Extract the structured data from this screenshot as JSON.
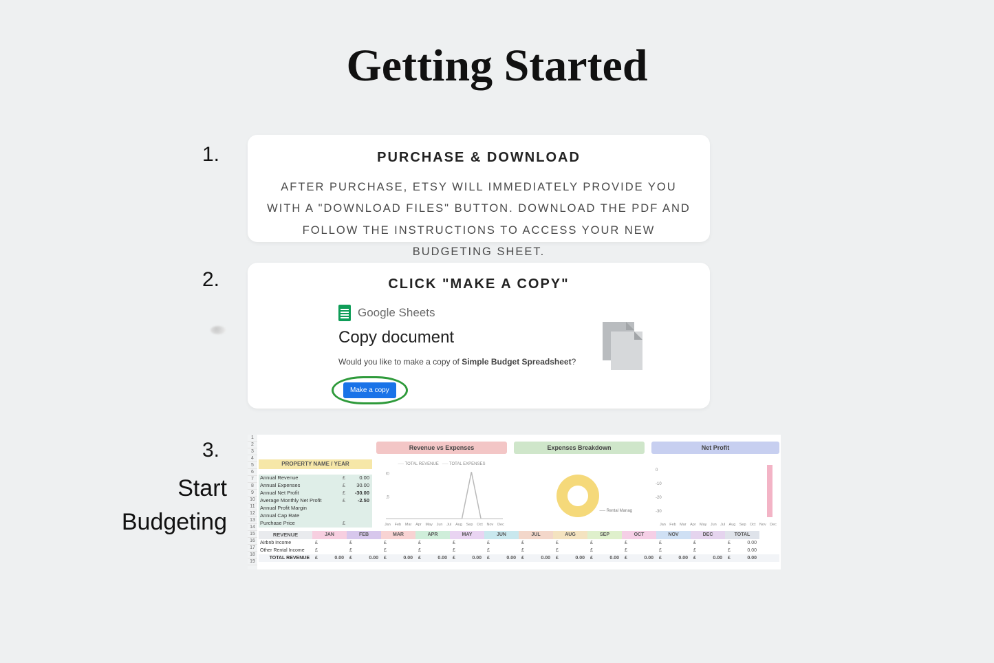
{
  "title": "Getting Started",
  "steps": {
    "one": {
      "num": "1.",
      "heading": "PURCHASE & DOWNLOAD",
      "body": "AFTER PURCHASE, ETSY WILL IMMEDIATELY PROVIDE YOU WITH A \"DOWNLOAD FILES\" BUTTON. DOWNLOAD THE PDF AND FOLLOW THE INSTRUCTIONS TO ACCESS YOUR NEW BUDGETING SHEET."
    },
    "two": {
      "num": "2.",
      "heading": "CLICK \"MAKE A COPY\"",
      "gsheets_label": "Google Sheets",
      "copy_title": "Copy document",
      "prompt_prefix": "Would you like to make a copy of ",
      "prompt_bold": "Simple Budget Spreadsheet",
      "prompt_suffix": "?",
      "button": "Make a copy"
    },
    "three": {
      "num": "3.",
      "label_line1": "Start",
      "label_line2": "Budgeting"
    }
  },
  "sheet": {
    "row_numbers": [
      "1",
      "2",
      "3",
      "4",
      "5",
      "6",
      "7",
      "8",
      "9",
      "10",
      "11",
      "12",
      "13",
      "14",
      "15",
      "16",
      "17",
      "18",
      "19"
    ],
    "property_header": "PROPERTY NAME / YEAR",
    "kpis": [
      {
        "label": "Annual Revenue",
        "currency": "£",
        "value": "0.00"
      },
      {
        "label": "Annual Expenses",
        "currency": "£",
        "value": "30.00"
      },
      {
        "label": "Annual Net Profit",
        "currency": "£",
        "value": "-30.00"
      },
      {
        "label": "Average Monthly Net Profit",
        "currency": "£",
        "value": "-2.50"
      },
      {
        "label": "Annual Profit Margin",
        "currency": "",
        "value": ""
      },
      {
        "label": "Annual Cap Rate",
        "currency": "",
        "value": ""
      },
      {
        "label": "Purchase Price",
        "currency": "£",
        "value": ""
      }
    ],
    "chart_headers": {
      "rev": "Revenue vs Expenses",
      "exp": "Expenses Breakdown",
      "net": "Net Profit"
    },
    "legend": {
      "total_revenue": "TOTAL REVENUE",
      "total_expenses": "TOTAL EXPENSES"
    },
    "donut_label": "Rental Manag",
    "months_short": [
      "Jan",
      "Feb",
      "Mar",
      "Apr",
      "May",
      "Jun",
      "Jul",
      "Aug",
      "Sep",
      "Oct",
      "Nov",
      "Dec"
    ],
    "net_ticks": [
      "0",
      "-10",
      "-20",
      "-30"
    ],
    "table": {
      "row_label_header": "REVENUE",
      "months": [
        "JAN",
        "FEB",
        "MAR",
        "APR",
        "MAY",
        "JUN",
        "JUL",
        "AUG",
        "SEP",
        "OCT",
        "NOV",
        "DEC",
        "TOTAL"
      ],
      "month_colors": [
        "#f7cfe0",
        "#d7c7ec",
        "#f8d3d3",
        "#cfeeda",
        "#e9d4f2",
        "#c9e8ee",
        "#f3d7ca",
        "#f4e3c0",
        "#dff0cc",
        "#f5cfe6",
        "#cfe0f4",
        "#e5d4ee",
        "#dfe3ea"
      ],
      "rows": [
        {
          "label": "Airbnb Income",
          "cells": [
            "£",
            "£",
            "£",
            "£",
            "£",
            "£",
            "£",
            "£",
            "£",
            "£",
            "£",
            "£",
            "£"
          ],
          "total": "0.00"
        },
        {
          "label": "Other Rental Income",
          "cells": [
            "£",
            "£",
            "£",
            "£",
            "£",
            "£",
            "£",
            "£",
            "£",
            "£",
            "£",
            "£",
            "£"
          ],
          "total": "0.00"
        }
      ],
      "total_row": {
        "label": "TOTAL REVENUE",
        "cells": [
          "0.00",
          "0.00",
          "0.00",
          "0.00",
          "0.00",
          "0.00",
          "0.00",
          "0.00",
          "0.00",
          "0.00",
          "0.00",
          "0.00",
          "0.00"
        ],
        "currency": "£"
      }
    }
  },
  "chart_data": [
    {
      "type": "line",
      "title": "Revenue vs Expenses",
      "x": [
        "Jan",
        "Feb",
        "Mar",
        "Apr",
        "May",
        "Jun",
        "Jul",
        "Aug",
        "Sep",
        "Oct",
        "Nov",
        "Dec"
      ],
      "series": [
        {
          "name": "TOTAL REVENUE",
          "values": [
            0,
            0,
            0,
            0,
            0,
            0,
            0,
            0,
            0,
            0,
            0,
            0
          ]
        },
        {
          "name": "TOTAL EXPENSES",
          "values": [
            0,
            0,
            0,
            0,
            0,
            0,
            0,
            0,
            30,
            0,
            0,
            0
          ]
        }
      ],
      "ylim": [
        0,
        30
      ]
    },
    {
      "type": "pie",
      "title": "Expenses Breakdown",
      "categories": [
        "Rental Manag"
      ],
      "values": [
        30
      ]
    },
    {
      "type": "bar",
      "title": "Net Profit",
      "categories": [
        "Jan",
        "Feb",
        "Mar",
        "Apr",
        "May",
        "Jun",
        "Jul",
        "Aug",
        "Sep",
        "Oct",
        "Nov",
        "Dec"
      ],
      "values": [
        0,
        0,
        0,
        0,
        0,
        0,
        0,
        0,
        0,
        0,
        0,
        -30
      ],
      "ylim": [
        -30,
        0
      ]
    }
  ]
}
